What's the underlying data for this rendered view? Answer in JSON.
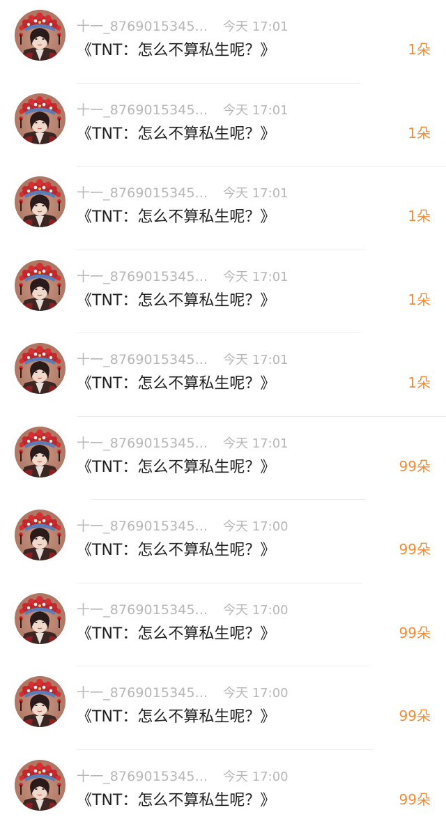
{
  "accent_color": "#f08a35",
  "items": [
    {
      "username": "十一_8769015345...",
      "time": "今天 17:01",
      "title": "《TNT：怎么不算私生呢？》",
      "count": "1朵"
    },
    {
      "username": "十一_8769015345...",
      "time": "今天 17:01",
      "title": "《TNT：怎么不算私生呢？》",
      "count": "1朵"
    },
    {
      "username": "十一_8769015345...",
      "time": "今天 17:01",
      "title": "《TNT：怎么不算私生呢？》",
      "count": "1朵"
    },
    {
      "username": "十一_8769015345...",
      "time": "今天 17:01",
      "title": "《TNT：怎么不算私生呢？》",
      "count": "1朵"
    },
    {
      "username": "十一_8769015345...",
      "time": "今天 17:01",
      "title": "《TNT：怎么不算私生呢？》",
      "count": "1朵"
    },
    {
      "username": "十一_8769015345...",
      "time": "今天 17:01",
      "title": "《TNT：怎么不算私生呢？》",
      "count": "99朵"
    },
    {
      "username": "十一_8769015345...",
      "time": "今天 17:00",
      "title": "《TNT：怎么不算私生呢？》",
      "count": "99朵"
    },
    {
      "username": "十一_8769015345...",
      "time": "今天 17:00",
      "title": "《TNT：怎么不算私生呢？》",
      "count": "99朵"
    },
    {
      "username": "十一_8769015345...",
      "time": "今天 17:00",
      "title": "《TNT：怎么不算私生呢？》",
      "count": "99朵"
    },
    {
      "username": "十一_8769015345...",
      "time": "今天 17:00",
      "title": "《TNT：怎么不算私生呢？》",
      "count": "99朵"
    }
  ]
}
